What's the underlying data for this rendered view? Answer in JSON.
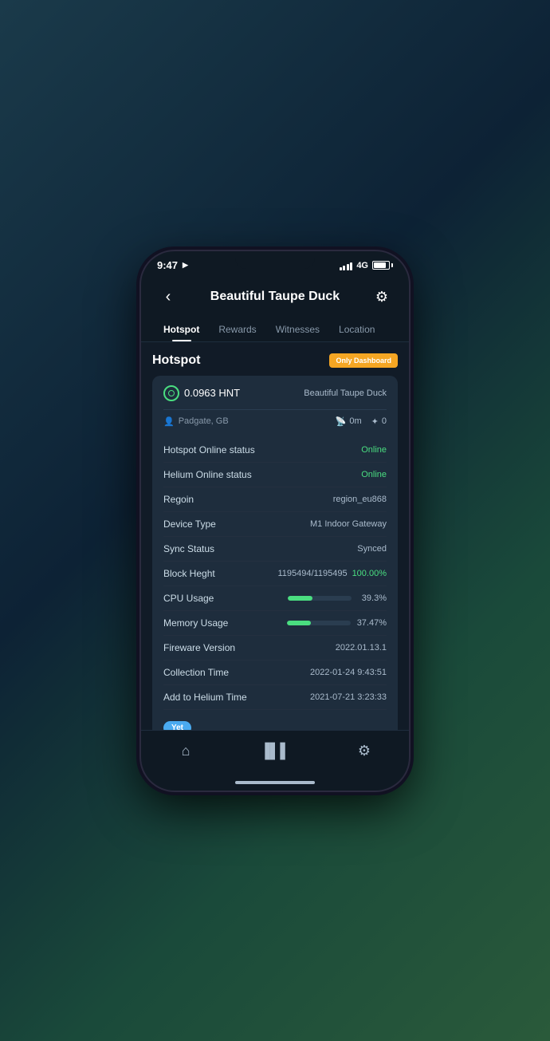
{
  "status_bar": {
    "time": "9:47",
    "location_arrow": "➤",
    "signal_label": "4G",
    "battery_level": 85
  },
  "header": {
    "back_label": "‹",
    "title": "Beautiful Taupe Duck",
    "settings_icon": "⚙"
  },
  "tabs": [
    {
      "id": "hotspot",
      "label": "Hotspot",
      "active": true
    },
    {
      "id": "rewards",
      "label": "Rewards",
      "active": false
    },
    {
      "id": "witnesses",
      "label": "Witnesses",
      "active": false
    },
    {
      "id": "location",
      "label": "Location",
      "active": false
    }
  ],
  "section": {
    "title": "Hotspot",
    "badge": "Only Dashboard"
  },
  "card": {
    "hnt_balance": "0.0963 HNT",
    "device_name": "Beautiful Taupe Duck",
    "location": "Padgate, GB",
    "distance": "0m",
    "scale": "0"
  },
  "stats": [
    {
      "label": "Hotspot Online status",
      "value": "Online",
      "type": "online"
    },
    {
      "label": "Helium Online status",
      "value": "Online",
      "type": "online"
    },
    {
      "label": "Regoin",
      "value": "region_eu868",
      "type": "text"
    },
    {
      "label": "Device Type",
      "value": "M1 Indoor Gateway",
      "type": "text"
    },
    {
      "label": "Sync Status",
      "value": "Synced",
      "type": "text"
    }
  ],
  "block_height": {
    "label": "Block Heght",
    "value": "1195494/1195495",
    "percent": "100.00%"
  },
  "cpu_usage": {
    "label": "CPU Usage",
    "percent_num": 39.3,
    "percent_label": "39.3%"
  },
  "memory_usage": {
    "label": "Memory Usage",
    "percent_num": 37.47,
    "percent_label": "37.47%"
  },
  "more_stats": [
    {
      "label": "Fireware Version",
      "value": "2022.01.13.1"
    },
    {
      "label": "Collection Time",
      "value": "2022-01-24 9:43:51"
    },
    {
      "label": "Add to Helium Time",
      "value": "2021-07-21 3:23:33"
    }
  ],
  "yet_badge": "Yet",
  "bottom_nav": {
    "home_icon": "🏠",
    "stats_icon": "📊",
    "settings_icon": "⚙"
  }
}
